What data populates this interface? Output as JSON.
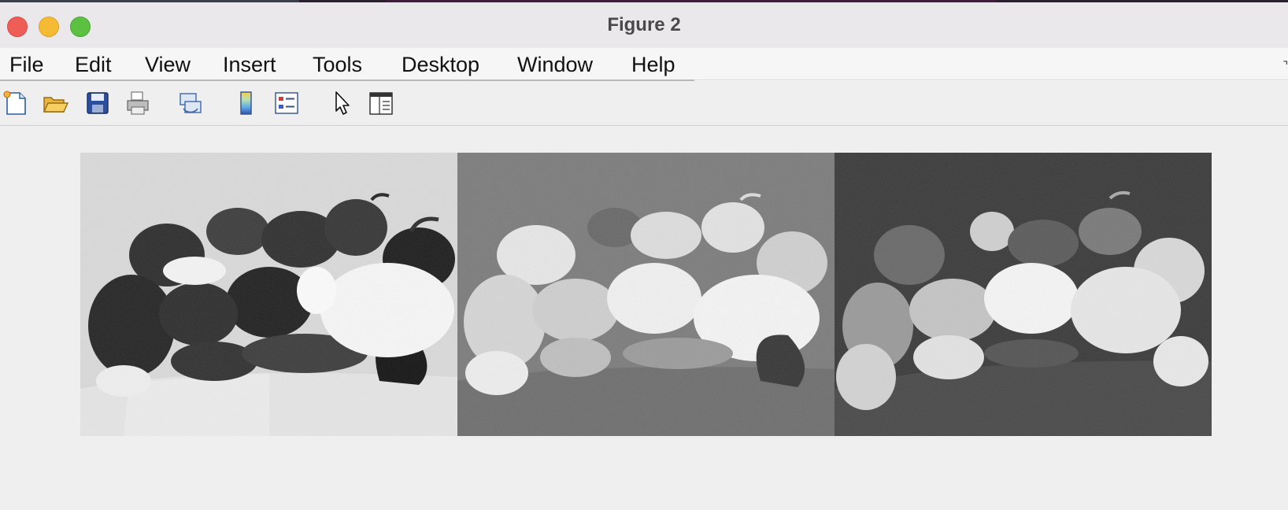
{
  "window": {
    "title": "Figure 2"
  },
  "menubar": {
    "items": [
      "File",
      "Edit",
      "View",
      "Insert",
      "Tools",
      "Desktop",
      "Window",
      "Help"
    ]
  },
  "toolbar": {
    "tools": [
      "new-figure-icon",
      "open-file-icon",
      "save-icon",
      "print-icon",
      "link-plot-icon",
      "colorbar-icon",
      "legend-icon",
      "edit-plot-pointer-icon",
      "property-inspector-icon"
    ]
  },
  "figure": {
    "panels": [
      {
        "content": "peppers-image",
        "rendering": "inverted-hue-grayscale",
        "background": "#d9d9d9"
      },
      {
        "content": "peppers-image",
        "rendering": "saturation-grayscale",
        "background": "#7d7d7d"
      },
      {
        "content": "peppers-image",
        "rendering": "value-grayscale",
        "background": "#3a3a3a"
      }
    ]
  },
  "colors": {
    "titlebar": "#ebe8ec",
    "menubar": "#f6f6f6",
    "toolbar": "#efefef"
  }
}
